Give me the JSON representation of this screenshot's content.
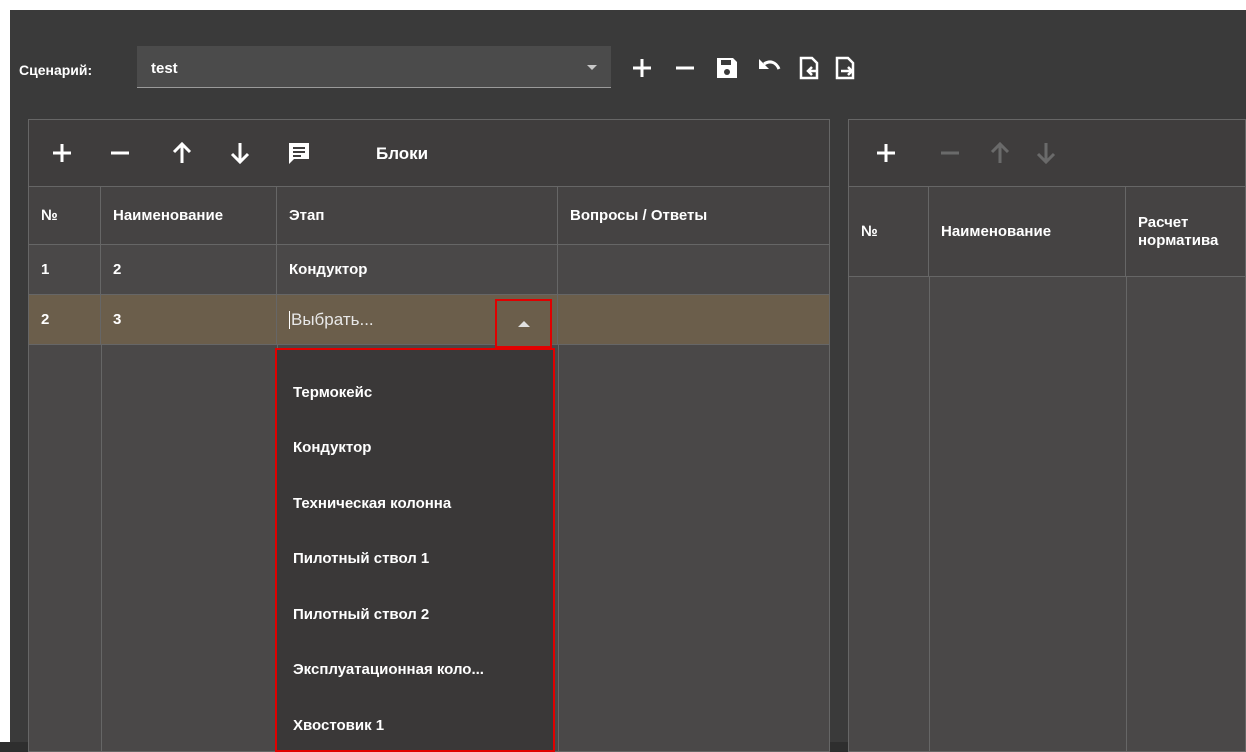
{
  "toolbar": {
    "scenario_label": "Сценарий:",
    "scenario_value": "test",
    "icons": [
      "plus-icon",
      "minus-icon",
      "save-icon",
      "undo-icon",
      "import-icon",
      "export-icon"
    ]
  },
  "blocks_panel": {
    "title": "Блоки",
    "icons": [
      "plus-icon",
      "minus-icon",
      "arrow-up-icon",
      "arrow-down-icon",
      "comment-icon"
    ],
    "columns": [
      "№",
      "Наименование",
      "Этап",
      "Вопросы / Ответы"
    ],
    "rows": [
      {
        "num": "1",
        "name": "2",
        "stage": "Кондуктор",
        "qa": ""
      },
      {
        "num": "2",
        "name": "3",
        "stage": "Выбрать...",
        "qa": ""
      }
    ]
  },
  "stage_dropdown": {
    "placeholder": "Выбрать...",
    "options": [
      "Термокейс",
      "Кондуктор",
      "Техническая колонна",
      "Пилотный ствол 1",
      "Пилотный ствол 2",
      "Эксплуатационная коло...",
      "Хвостовик 1"
    ]
  },
  "right_panel": {
    "icons": [
      "plus-icon",
      "minus-icon",
      "arrow-up-icon",
      "arrow-down-icon"
    ],
    "columns": [
      "№",
      "Наименование",
      "Расчет норматива"
    ]
  },
  "colors": {
    "selected_row": "#6b5e4b",
    "highlight_border": "#e00000",
    "panel_bg": "#4a4848",
    "app_bg": "#3a3a3a"
  }
}
